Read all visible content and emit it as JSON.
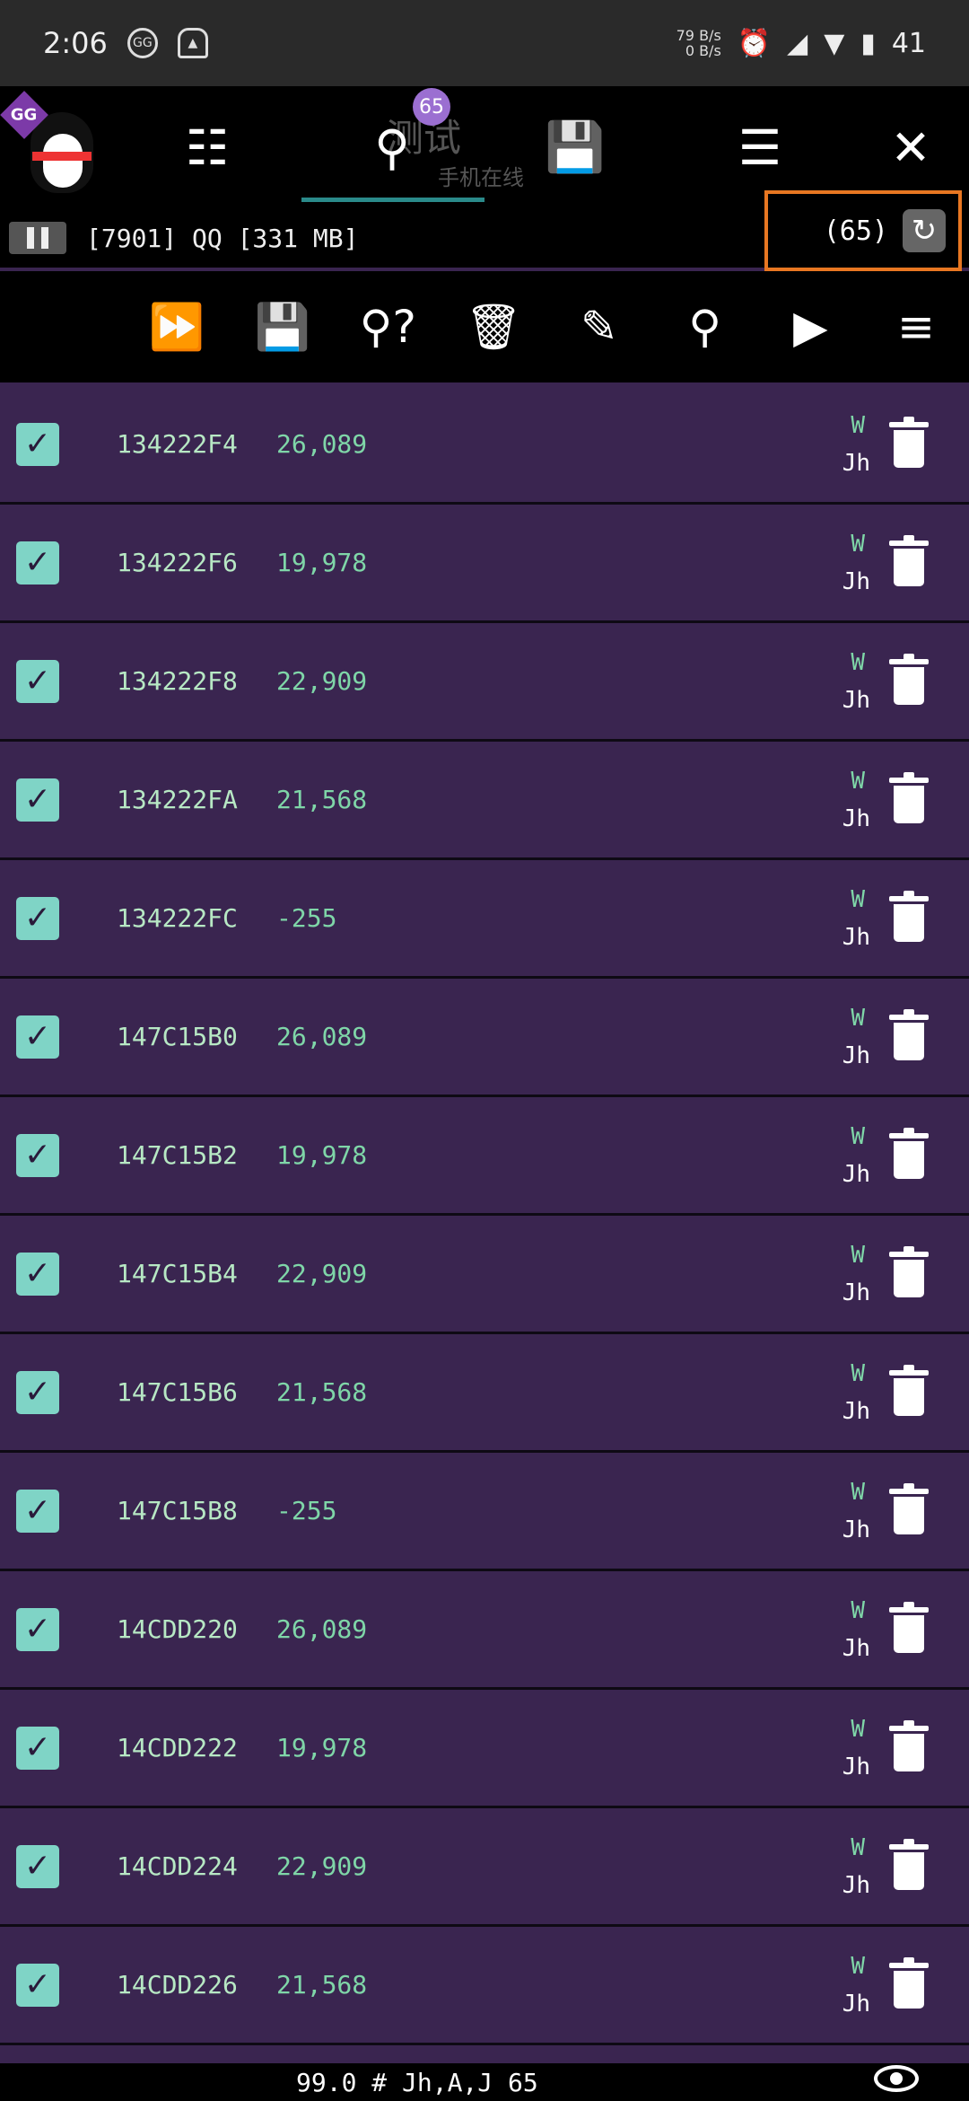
{
  "status": {
    "time": "2:06",
    "net_up": "79 B/s",
    "net_down": "0 B/s",
    "battery": "41"
  },
  "toolbar_top": {
    "badge": "65",
    "ghost_title": "测试",
    "ghost_subtitle": "手机在线"
  },
  "process": {
    "label": "[7901] QQ [331 MB]",
    "count": "(65)"
  },
  "icons": {
    "top": [
      "gg-logo-icon",
      "sliders-icon",
      "search-icon",
      "save-icon",
      "list-icon",
      "close-icon"
    ],
    "tools": [
      "fast-forward-icon",
      "save-icon",
      "search-question-icon",
      "trash-icon",
      "edit-icon",
      "search-icon",
      "play-icon",
      "menu-icon"
    ]
  },
  "rows": [
    {
      "addr": "134222F4",
      "value": "26,089",
      "type_w": "W",
      "type_j": "Jh"
    },
    {
      "addr": "134222F6",
      "value": "19,978",
      "type_w": "W",
      "type_j": "Jh"
    },
    {
      "addr": "134222F8",
      "value": "22,909",
      "type_w": "W",
      "type_j": "Jh"
    },
    {
      "addr": "134222FA",
      "value": "21,568",
      "type_w": "W",
      "type_j": "Jh"
    },
    {
      "addr": "134222FC",
      "value": "-255",
      "type_w": "W",
      "type_j": "Jh"
    },
    {
      "addr": "147C15B0",
      "value": "26,089",
      "type_w": "W",
      "type_j": "Jh"
    },
    {
      "addr": "147C15B2",
      "value": "19,978",
      "type_w": "W",
      "type_j": "Jh"
    },
    {
      "addr": "147C15B4",
      "value": "22,909",
      "type_w": "W",
      "type_j": "Jh"
    },
    {
      "addr": "147C15B6",
      "value": "21,568",
      "type_w": "W",
      "type_j": "Jh"
    },
    {
      "addr": "147C15B8",
      "value": "-255",
      "type_w": "W",
      "type_j": "Jh"
    },
    {
      "addr": "14CDD220",
      "value": "26,089",
      "type_w": "W",
      "type_j": "Jh"
    },
    {
      "addr": "14CDD222",
      "value": "19,978",
      "type_w": "W",
      "type_j": "Jh"
    },
    {
      "addr": "14CDD224",
      "value": "22,909",
      "type_w": "W",
      "type_j": "Jh"
    },
    {
      "addr": "14CDD226",
      "value": "21,568",
      "type_w": "W",
      "type_j": "Jh"
    }
  ],
  "footer": {
    "text": "99.0 # Jh,A,J 65"
  },
  "colors": {
    "accent": "#7fd4c6",
    "highlight": "#e87722",
    "row_bg": "#3a2550"
  }
}
